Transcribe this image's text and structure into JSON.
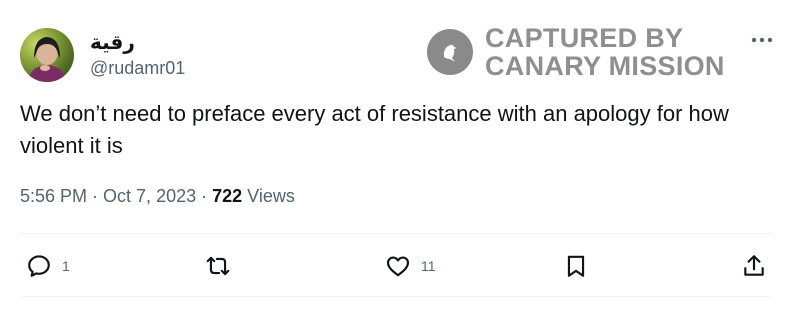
{
  "author": {
    "display_name": "رقية",
    "handle": "@rudamr01"
  },
  "watermark": {
    "line1": "CAPTURED BY",
    "line2": "CANARY MISSION"
  },
  "tweet": {
    "text": "We don’t need to preface every act of resistance with an apology for how violent it is"
  },
  "meta": {
    "time": "5:56 PM",
    "separator1": " · ",
    "date": "Oct 7, 2023",
    "separator2": " · ",
    "views_count": "722",
    "views_label": " Views"
  },
  "actions": {
    "reply_count": "1",
    "like_count": "11"
  },
  "icons": {
    "more": "more-horizontal-icon",
    "reply": "reply-icon",
    "retweet": "retweet-icon",
    "like": "heart-icon",
    "bookmark": "bookmark-icon",
    "share": "share-icon"
  }
}
